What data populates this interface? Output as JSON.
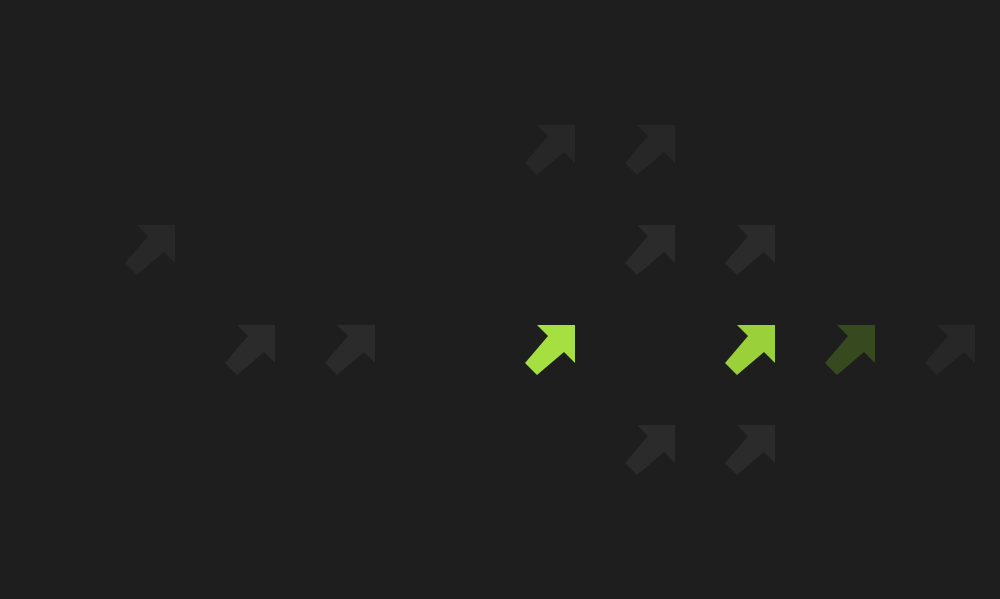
{
  "background": "#1e1e1e",
  "colors": {
    "dim": "#2b2b2b",
    "dimmer": "#272727",
    "bright": "#a6e040",
    "bright_alt": "#9ad13a",
    "muted_green": "#37491f",
    "faint": "#282828"
  },
  "icon": "arrow-up-right-icon",
  "arrows": [
    {
      "row": 1,
      "col": 5,
      "tone": "dimmer"
    },
    {
      "row": 1,
      "col": 6,
      "tone": "dimmer"
    },
    {
      "row": 2,
      "col": 1,
      "tone": "faint"
    },
    {
      "row": 2,
      "col": 6,
      "tone": "dim"
    },
    {
      "row": 2,
      "col": 7,
      "tone": "dim"
    },
    {
      "row": 3,
      "col": 2,
      "tone": "dim"
    },
    {
      "row": 3,
      "col": 3,
      "tone": "dim"
    },
    {
      "row": 3,
      "col": 5,
      "tone": "bright"
    },
    {
      "row": 3,
      "col": 7,
      "tone": "bright_alt"
    },
    {
      "row": 3,
      "col": 8,
      "tone": "muted_green"
    },
    {
      "row": 3,
      "col": 9,
      "tone": "dimmer"
    },
    {
      "row": 4,
      "col": 6,
      "tone": "dim"
    },
    {
      "row": 4,
      "col": 7,
      "tone": "dim"
    }
  ]
}
